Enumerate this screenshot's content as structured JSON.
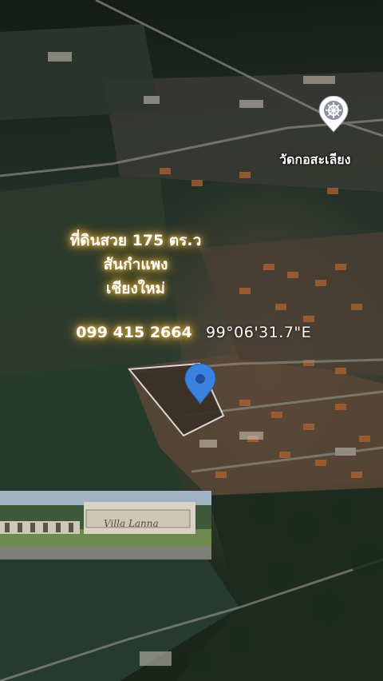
{
  "map": {
    "place_label": "วัดกอสะเลียง",
    "coordinate_text": "99°06'31.7\"E"
  },
  "overlay": {
    "title_line1": "ที่ดินสวย 175 ตร.ว",
    "title_line2": "สันกำแพง",
    "title_line3": "เชียงใหม่",
    "phone": "099 415 2664"
  },
  "inset": {
    "sign_text": "Villa Lanna"
  },
  "icons": {
    "temple_marker": "temple-marker-icon",
    "location_pin": "location-pin-icon"
  },
  "colors": {
    "pin_blue": "#3b82e0",
    "glow": "#e8c25a"
  }
}
